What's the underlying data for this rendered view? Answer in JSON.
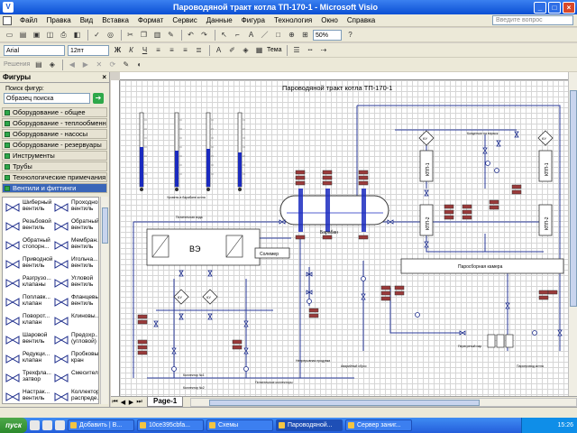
{
  "window": {
    "title": "Пароводяной тракт котла ТП-170-1  - Microsoft Visio"
  },
  "menu": [
    "Файл",
    "Правка",
    "Вид",
    "Вставка",
    "Формат",
    "Сервис",
    "Данные",
    "Фигура",
    "Технология",
    "Окно",
    "Справка"
  ],
  "ask_placeholder": "Введите вопрос",
  "toolbar": {
    "zoom": "50%",
    "font": "Arial",
    "font_size": "12пт",
    "theme_label": "Тема",
    "solutions_label": "Решения"
  },
  "shapes_panel": {
    "title": "Фигуры",
    "search_label": "Поиск фигур:",
    "search_placeholder": "Образец поиска",
    "stencils": [
      "Оборудование - общее",
      "Оборудование - теплообменники",
      "Оборудование - насосы",
      "Оборудование - резервуары",
      "Инструменты",
      "Трубы",
      "Технологические примечания",
      "Вентили и фиттинги"
    ],
    "shapes": [
      {
        "a": "Шиберный",
        "b": "вентиль"
      },
      {
        "a": "Проходной",
        "b": "вентиль"
      },
      {
        "a": "Резьбовой",
        "b": "вентиль"
      },
      {
        "a": "Обратный",
        "b": "вентиль"
      },
      {
        "a": "Обратный",
        "b": "стопорн..."
      },
      {
        "a": "Мембран...",
        "b": "вентиль"
      },
      {
        "a": "Приводной",
        "b": "вентиль"
      },
      {
        "a": "Игольча...",
        "b": "вентиль"
      },
      {
        "a": "Разгрузо...",
        "b": "клапаны"
      },
      {
        "a": "Угловой",
        "b": "вентиль"
      },
      {
        "a": "Поплавк...",
        "b": "клапан"
      },
      {
        "a": "Фланцевый",
        "b": "вентиль"
      },
      {
        "a": "Поворот...",
        "b": "клапан"
      },
      {
        "a": "Клиновы...",
        "b": ""
      },
      {
        "a": "Шаровой",
        "b": "вентиль"
      },
      {
        "a": "Предохр...",
        "b": "(угловой)"
      },
      {
        "a": "Редукци...",
        "b": "клапан"
      },
      {
        "a": "Пробковый",
        "b": "кран"
      },
      {
        "a": "Трехфла...",
        "b": "затвор"
      },
      {
        "a": "Смеситель",
        "b": ""
      },
      {
        "a": "Настрак...",
        "b": "вентиль"
      },
      {
        "a": "Коллектор",
        "b": "распреде..."
      }
    ]
  },
  "diagram": {
    "title": "Пароводяной тракт котла ТП-170-1",
    "level_caption": "Уровень в барабане котла",
    "pipe_top": "Питательная вода",
    "we_label": "ВЭ",
    "solemer": "Солемер",
    "drum_label": "Барабан",
    "condensate_label": "Конденсат на впрыск",
    "steam_chamber": "Паросборная камера",
    "kpp1": "КПП-1",
    "kpp2": "КПП-2",
    "ku": "КУ",
    "continuous_blowdown": "Непрерывная продувка",
    "emergency_drain": "Аварийный сброс",
    "superheated_steam": "Перегретый пар",
    "steam_main": "Паропровод котла",
    "feed_collector1": "Коллектор №1",
    "feed_collector2": "Коллектор №2",
    "feed_collectors": "Питательные коллекторы"
  },
  "page_tab": "Page-1",
  "taskbar": {
    "start": "пуск",
    "tasks": [
      "Добавить | B...",
      "10ce395cbfa...",
      "Схемы",
      "Пароводяной...",
      "Сервер заниг..."
    ],
    "clock": "15:26"
  }
}
